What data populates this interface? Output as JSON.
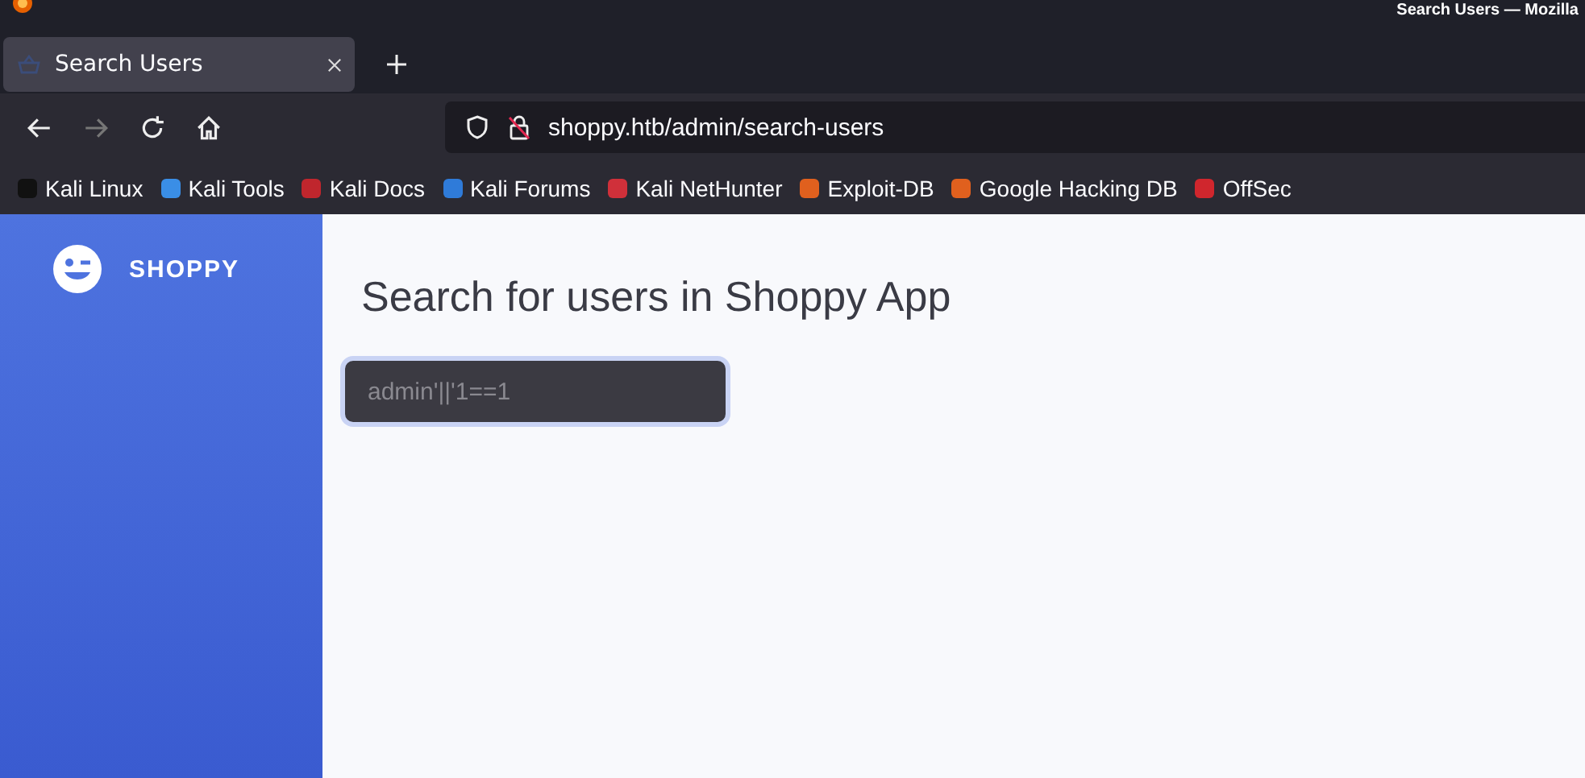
{
  "window": {
    "title": "Search Users — Mozilla"
  },
  "tabs": [
    {
      "label": "Search Users",
      "selected": true
    }
  ],
  "address_bar": {
    "url": "shoppy.htb/admin/search-users"
  },
  "bookmarks": [
    {
      "label": "Kali Linux",
      "color": "#111111"
    },
    {
      "label": "Kali Tools",
      "color": "#3a8ee6"
    },
    {
      "label": "Kali Docs",
      "color": "#c0262d"
    },
    {
      "label": "Kali Forums",
      "color": "#2f7bd9"
    },
    {
      "label": "Kali NetHunter",
      "color": "#d0303a"
    },
    {
      "label": "Exploit-DB",
      "color": "#e0601e"
    },
    {
      "label": "Google Hacking DB",
      "color": "#e0601e"
    },
    {
      "label": "OffSec",
      "color": "#d0262d"
    }
  ],
  "sidebar": {
    "brand": "SHOPPY"
  },
  "page": {
    "heading": "Search for users in Shoppy App",
    "search": {
      "value": "admin'||'1==1"
    }
  }
}
